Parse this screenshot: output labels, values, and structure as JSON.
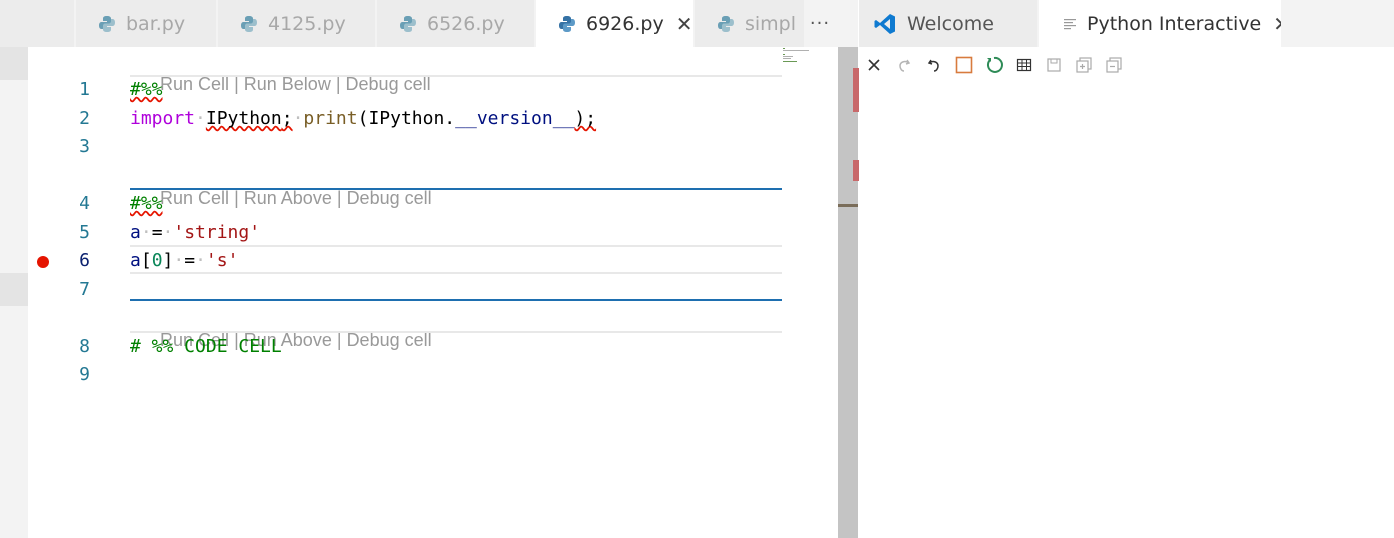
{
  "left_tabs": [
    {
      "label": "bar.py",
      "active": false,
      "icon": "python-icon"
    },
    {
      "label": "4125.py",
      "active": false,
      "icon": "python-icon"
    },
    {
      "label": "6526.py",
      "active": false,
      "icon": "python-icon"
    },
    {
      "label": "6926.py",
      "active": true,
      "icon": "python-icon"
    },
    {
      "label": "simpl",
      "active": false,
      "icon": "python-icon"
    }
  ],
  "left_more": "···",
  "right_tabs": [
    {
      "label": "Welcome",
      "icon": "vscode-logo-icon"
    },
    {
      "label": "Python Interactive",
      "icon": "preview-icon"
    }
  ],
  "code_lens": [
    {
      "run": "Run Cell",
      "sep": "|",
      "other": "Run Below",
      "debug": "Debug cell"
    },
    {
      "run": "Run Cell",
      "sep": "|",
      "other": "Run Above",
      "debug": "Debug cell"
    },
    {
      "run": "Run Cell",
      "sep": "|",
      "other": "Run Above",
      "debug": "Debug cell"
    }
  ],
  "line_numbers": [
    "1",
    "2",
    "3",
    "4",
    "5",
    "6",
    "7",
    "8",
    "9"
  ],
  "code": {
    "l1": "#%%",
    "l2_kw": "import",
    "l2_mod": "IPython",
    "l2_semi": ";",
    "l2_fn": "print",
    "l2_rest": "(IPython.",
    "l2_attr": "__version__",
    "l2_end": ");",
    "l4": "#%%",
    "l5_var": "a",
    "l5_eq": "=",
    "l5_str": "'string'",
    "l6_var": "a",
    "l6_open": "[",
    "l6_num": "0",
    "l6_close": "]",
    "l6_eq": "=",
    "l6_str": "'s'",
    "l8": "# %% CODE CELL"
  },
  "toolbar_icons": [
    "close-all-icon",
    "redo-icon",
    "undo-icon",
    "interrupt-icon",
    "restart-icon",
    "variables-icon",
    "save-icon",
    "expand-all-icon",
    "collapse-all-icon"
  ],
  "colors": {
    "accent": "#1e6fb0",
    "breakpoint": "#e51400",
    "restart": "#2e8b57",
    "interrupt": "#d87b3e"
  }
}
